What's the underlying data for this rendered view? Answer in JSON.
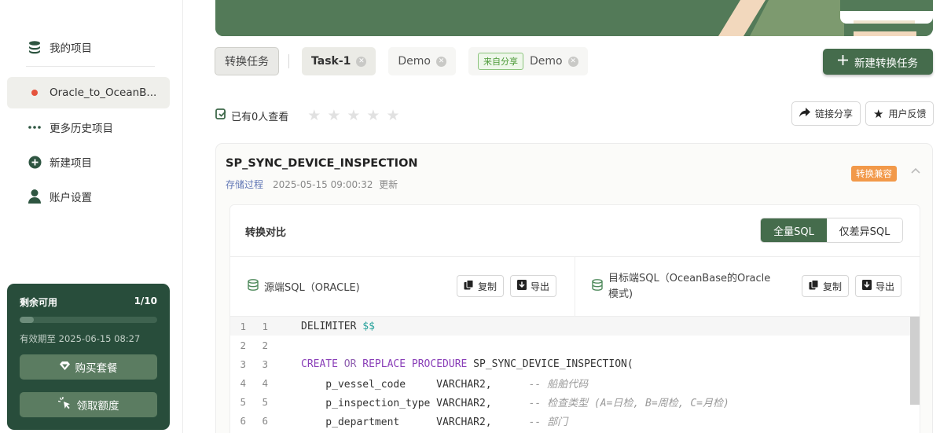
{
  "sidebar": {
    "items": [
      {
        "label": "我的项目",
        "icon": "database-icon"
      },
      {
        "label": "Oracle_to_OceanB...",
        "icon": "dot-icon",
        "active": true
      },
      {
        "label": "更多历史项目",
        "icon": "ellipsis-icon"
      },
      {
        "label": "新建项目",
        "icon": "plus-circle-icon"
      },
      {
        "label": "账户设置",
        "icon": "user-icon"
      }
    ],
    "quota": {
      "title": "剩余可用",
      "count": "1/10",
      "progress": 0.1,
      "expire": "有效期至 2025-06-15 08:27",
      "buy_label": "购买套餐",
      "claim_label": "领取额度"
    }
  },
  "tabs": {
    "convert_label": "转换任务",
    "items": [
      {
        "label": "Task-1"
      },
      {
        "label": "Demo"
      },
      {
        "label": "Demo",
        "tag": "来自分享"
      }
    ],
    "new_task_label": "新建转换任务"
  },
  "viewers": {
    "text": "已有0人查看",
    "rating": 0,
    "share_label": "链接分享",
    "feedback_label": "用户反馈"
  },
  "card": {
    "title": "SP_SYNC_DEVICE_INSPECTION",
    "type": "存储过程",
    "updated": "2025-05-15 09:00:32",
    "updated_suffix": "更新",
    "badge": "转换兼容",
    "compare_label": "转换对比",
    "full_sql": "全量SQL",
    "diff_sql": "仅差异SQL",
    "source_label": "源端SQL（ORACLE)",
    "target_label": "目标端SQL（OceanBase的Oracle模式)",
    "copy_label": "复制",
    "export_label": "导出"
  },
  "colors": {
    "brand": "#456c4c",
    "quota_bg": "#284d3b",
    "badge": "#f2994a",
    "keyword": "#8a3fb8"
  },
  "code": [
    {
      "n1": "1",
      "n2": "1",
      "text": "DELIMITER $$"
    },
    {
      "n1": "2",
      "n2": "2",
      "text": ""
    },
    {
      "n1": "3",
      "n2": "3",
      "text": "CREATE OR REPLACE PROCEDURE SP_SYNC_DEVICE_INSPECTION("
    },
    {
      "n1": "4",
      "n2": "4",
      "text": "    p_vessel_code     VARCHAR2,      -- 船舶代码"
    },
    {
      "n1": "5",
      "n2": "5",
      "text": "    p_inspection_type VARCHAR2,      -- 检查类型 (A=日检, B=周检, C=月检)"
    },
    {
      "n1": "6",
      "n2": "6",
      "text": "    p_department      VARCHAR2,      -- 部门"
    }
  ]
}
